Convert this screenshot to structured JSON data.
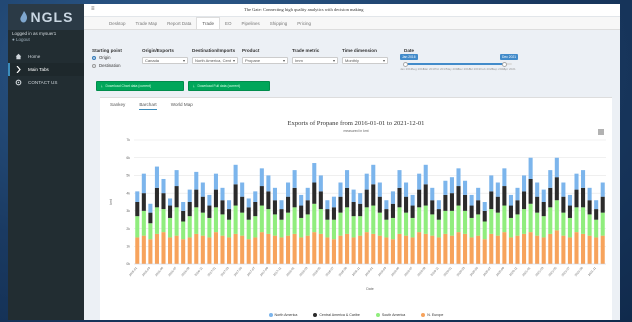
{
  "app": {
    "logo_text": "NGLS",
    "login_text": "Logged in as mysuer1",
    "status_text": "Logout"
  },
  "sidebar": {
    "items": [
      {
        "label": "Home",
        "icon": "home-icon"
      },
      {
        "label": "Main Tabs",
        "icon": "chevron-right-icon"
      },
      {
        "label": "CONTACT US",
        "icon": "gear-icon"
      }
    ]
  },
  "topbar": {
    "banner": "The Gate: Connecting high quality analytics with decision making"
  },
  "tabs": [
    "Desktop",
    "Trade Map",
    "Report Data",
    "Trade",
    "EO",
    "Pipelines",
    "Shipping",
    "Pricing"
  ],
  "controls": {
    "starting_point": {
      "label": "Starting point",
      "options": [
        "Origin",
        "Destination"
      ],
      "selected": "Origin"
    },
    "origin": {
      "label": "Origin/Exports",
      "value": "Canada"
    },
    "destination": {
      "label": "Destination/Imports",
      "value": "North America, Cent"
    },
    "product": {
      "label": "Product",
      "value": "Propane"
    },
    "trade_metric": {
      "label": "Trade metric",
      "value": "Imm"
    },
    "time_dimension": {
      "label": "Time dimension",
      "value": "Monthly"
    },
    "date": {
      "label": "Date",
      "start": "Jan 2016",
      "end": "Dec 2021",
      "ticks": [
        "Jan 2016",
        "Aug 2016",
        "Mar 2017",
        "Oct 2017",
        "May 2018",
        "Dec 2018",
        "Jul 2019",
        "Feb 2020",
        "Sep 2020",
        "Apr 2021"
      ]
    }
  },
  "buttons": {
    "download_chart": "Download Chart data (current)",
    "download_full": "Download Full data (current)"
  },
  "view_tabs": [
    "Sankey",
    "Barchart",
    "World Map"
  ],
  "active_view": "Barchart",
  "colors": {
    "north_america": "#7cb5ec",
    "central_america": "#2b2b2b",
    "south_america": "#90ed7d",
    "europe": "#f7a35c"
  },
  "chart_data": {
    "type": "bar",
    "stacked": true,
    "title": "Exports of Propane from 2016-01-01 to 2021-12-01",
    "subtitle": "measured in kmt",
    "ylabel": "kmt",
    "xlabel": "Date",
    "ylim": [
      0,
      7
    ],
    "yticks": [
      0,
      1,
      2,
      3,
      4,
      5,
      6,
      7
    ],
    "grid": true,
    "legend_position": "bottom",
    "categories": [
      "2016-01",
      "2016-02",
      "2016-03",
      "2016-04",
      "2016-05",
      "2016-06",
      "2016-07",
      "2016-08",
      "2016-09",
      "2016-10",
      "2016-11",
      "2016-12",
      "2017-01",
      "2017-02",
      "2017-03",
      "2017-04",
      "2017-05",
      "2017-06",
      "2017-07",
      "2017-08",
      "2017-09",
      "2017-10",
      "2017-11",
      "2017-12",
      "2018-01",
      "2018-02",
      "2018-03",
      "2018-04",
      "2018-05",
      "2018-06",
      "2018-07",
      "2018-08",
      "2018-09",
      "2018-10",
      "2018-11",
      "2018-12",
      "2019-01",
      "2019-02",
      "2019-03",
      "2019-04",
      "2019-05",
      "2019-06",
      "2019-07",
      "2019-08",
      "2019-09",
      "2019-10",
      "2019-11",
      "2019-12",
      "2020-01",
      "2020-02",
      "2020-03",
      "2020-04",
      "2020-05",
      "2020-06",
      "2020-07",
      "2020-08",
      "2020-09",
      "2020-10",
      "2020-11",
      "2020-12",
      "2021-01",
      "2021-02",
      "2021-03",
      "2021-04",
      "2021-05",
      "2021-06",
      "2021-07",
      "2021-08",
      "2021-09",
      "2021-10",
      "2021-11",
      "2021-12"
    ],
    "series": [
      {
        "name": "N. Europe",
        "color": "#f7a35c",
        "values": [
          1.5,
          1.6,
          1.4,
          1.7,
          1.8,
          1.5,
          1.6,
          1.4,
          1.5,
          1.7,
          1.6,
          1.5,
          1.8,
          1.6,
          1.5,
          1.7,
          1.6,
          1.4,
          1.5,
          1.8,
          1.7,
          1.6,
          1.5,
          1.6,
          1.7,
          1.5,
          1.6,
          1.8,
          1.7,
          1.5,
          1.4,
          1.6,
          1.7,
          1.5,
          1.6,
          1.8,
          1.7,
          1.6,
          1.5,
          1.4,
          1.7,
          1.6,
          1.5,
          1.8,
          1.7,
          1.6,
          1.5,
          1.7,
          1.6,
          1.8,
          1.7,
          1.5,
          1.6,
          1.4,
          1.7,
          1.6,
          1.8,
          1.5,
          1.6,
          1.7,
          1.8,
          1.6,
          1.5,
          1.7,
          1.9,
          1.6,
          1.5,
          1.8,
          1.7,
          1.6,
          1.5,
          1.6
        ]
      },
      {
        "name": "South America",
        "color": "#90ed7d",
        "values": [
          1.2,
          1.4,
          0.9,
          1.5,
          1.3,
          1.1,
          1.6,
          1.0,
          1.2,
          1.5,
          1.3,
          1.1,
          1.4,
          1.2,
          1.0,
          1.6,
          1.3,
          1.1,
          1.2,
          1.5,
          1.4,
          1.2,
          1.0,
          1.3,
          1.5,
          1.1,
          1.2,
          1.6,
          1.4,
          1.0,
          1.1,
          1.3,
          1.5,
          1.2,
          1.1,
          1.4,
          1.6,
          1.3,
          1.0,
          1.2,
          1.5,
          1.3,
          1.1,
          1.4,
          1.6,
          1.2,
          1.0,
          1.3,
          1.4,
          1.5,
          1.3,
          1.1,
          1.2,
          1.0,
          1.4,
          1.3,
          1.5,
          1.1,
          1.2,
          1.4,
          1.6,
          1.3,
          1.2,
          1.5,
          1.7,
          1.3,
          1.1,
          1.4,
          1.5,
          1.2,
          1.0,
          1.3
        ]
      },
      {
        "name": "Central America & Caribe",
        "color": "#2b2b2b",
        "values": [
          0.8,
          1.0,
          0.6,
          1.1,
          0.9,
          0.7,
          1.2,
          0.6,
          0.8,
          1.0,
          0.9,
          0.7,
          1.0,
          0.8,
          0.6,
          1.2,
          0.9,
          0.7,
          0.8,
          1.1,
          1.0,
          0.8,
          0.6,
          0.9,
          1.1,
          0.7,
          0.8,
          1.2,
          1.0,
          0.6,
          0.7,
          0.9,
          1.1,
          0.8,
          0.7,
          1.0,
          1.2,
          0.9,
          0.6,
          0.8,
          1.1,
          0.9,
          0.7,
          1.0,
          1.2,
          0.8,
          0.6,
          0.9,
          1.0,
          1.1,
          0.9,
          0.7,
          0.8,
          0.6,
          1.0,
          0.9,
          1.1,
          0.7,
          0.8,
          1.0,
          1.4,
          0.9,
          0.8,
          1.1,
          1.3,
          0.9,
          0.7,
          1.0,
          1.1,
          0.8,
          0.6,
          0.9
        ]
      },
      {
        "name": "North America",
        "color": "#7cb5ec",
        "values": [
          0.6,
          1.1,
          0.5,
          1.2,
          0.8,
          0.4,
          0.9,
          0.5,
          0.7,
          1.0,
          0.8,
          0.6,
          0.9,
          0.7,
          0.5,
          1.1,
          0.8,
          0.5,
          0.6,
          1.0,
          0.9,
          0.7,
          0.5,
          0.8,
          1.0,
          0.6,
          0.7,
          1.1,
          0.9,
          0.5,
          0.6,
          0.8,
          1.0,
          0.7,
          0.6,
          0.9,
          1.1,
          0.8,
          0.5,
          0.7,
          1.0,
          0.8,
          0.6,
          0.9,
          1.1,
          0.7,
          0.5,
          0.8,
          0.9,
          1.0,
          0.8,
          0.6,
          0.7,
          0.5,
          0.9,
          0.8,
          1.0,
          0.6,
          0.7,
          0.9,
          1.2,
          0.8,
          0.7,
          1.0,
          1.1,
          0.8,
          0.6,
          0.9,
          1.0,
          0.7,
          0.5,
          0.8
        ]
      }
    ],
    "legend": [
      "North America",
      "Central America & Caribe",
      "South America",
      "N. Europe"
    ]
  }
}
